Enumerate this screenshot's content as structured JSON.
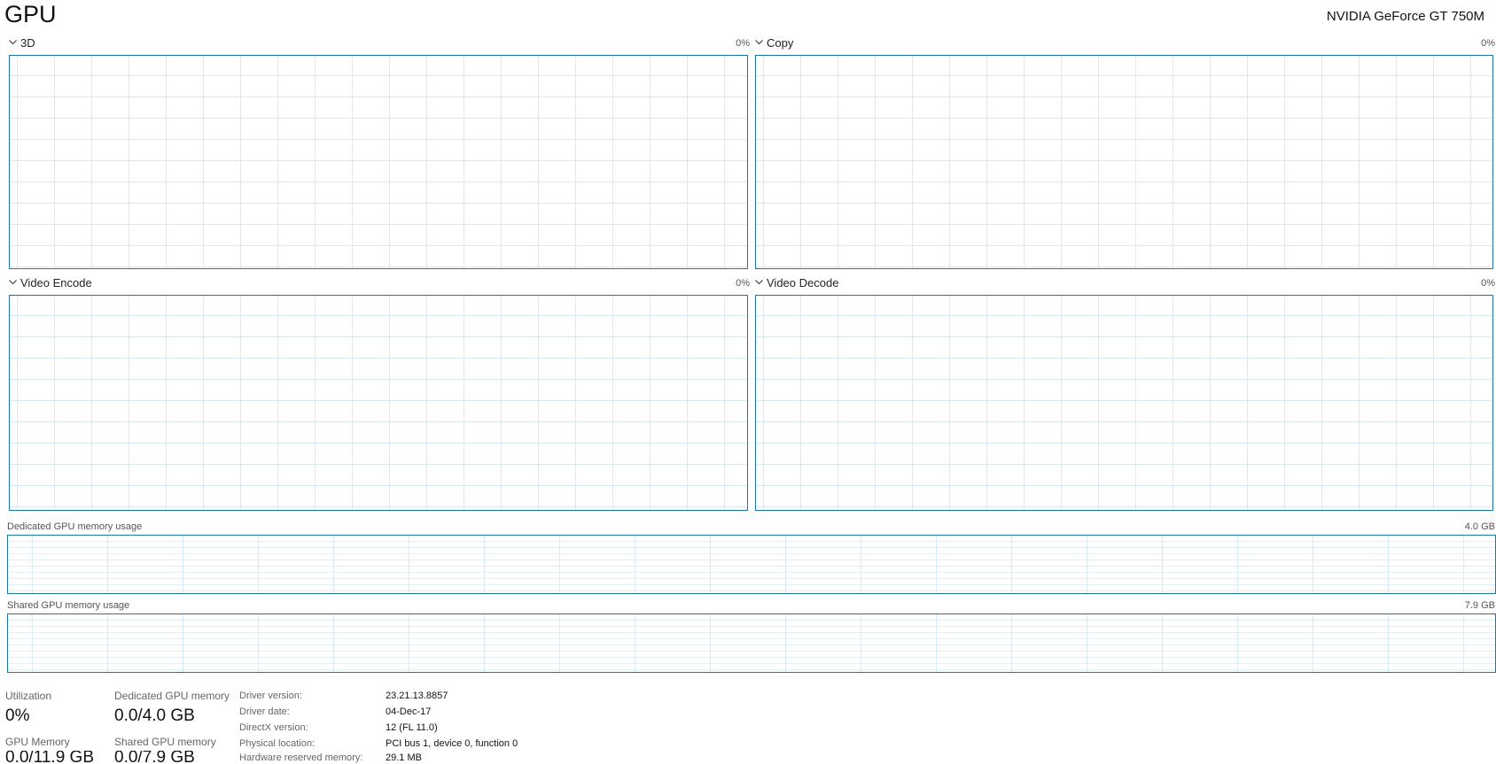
{
  "header": {
    "title": "GPU",
    "device_name": "NVIDIA GeForce GT 750M"
  },
  "engines": [
    {
      "name": "3D",
      "percent": "0%"
    },
    {
      "name": "Copy",
      "percent": "0%"
    },
    {
      "name": "Video Encode",
      "percent": "0%"
    },
    {
      "name": "Video Decode",
      "percent": "0%"
    }
  ],
  "memory_graphs": {
    "dedicated": {
      "label": "Dedicated GPU memory usage",
      "max": "4.0 GB"
    },
    "shared": {
      "label": "Shared GPU memory usage",
      "max": "7.9 GB"
    }
  },
  "stats": {
    "utilization": {
      "label": "Utilization",
      "value": "0%"
    },
    "dedicated_memory": {
      "label": "Dedicated GPU memory",
      "value": "0.0/4.0 GB"
    },
    "gpu_memory": {
      "label": "GPU Memory",
      "value": "0.0/11.9 GB"
    },
    "shared_memory": {
      "label": "Shared GPU memory",
      "value": "0.0/7.9 GB"
    }
  },
  "details": [
    {
      "label": "Driver version:",
      "value": "23.21.13.8857"
    },
    {
      "label": "Driver date:",
      "value": "04-Dec-17"
    },
    {
      "label": "DirectX version:",
      "value": "12 (FL 11.0)"
    },
    {
      "label": "Physical location:",
      "value": "PCI bus 1, device 0, function 0"
    },
    {
      "label": "Hardware reserved memory:",
      "value": "29.1 MB"
    }
  ],
  "colors": {
    "graph_border": "#1a78a8",
    "grid_line": "#d6eaf5"
  },
  "icons": {
    "engine_toggle": "chevron-down-icon"
  }
}
